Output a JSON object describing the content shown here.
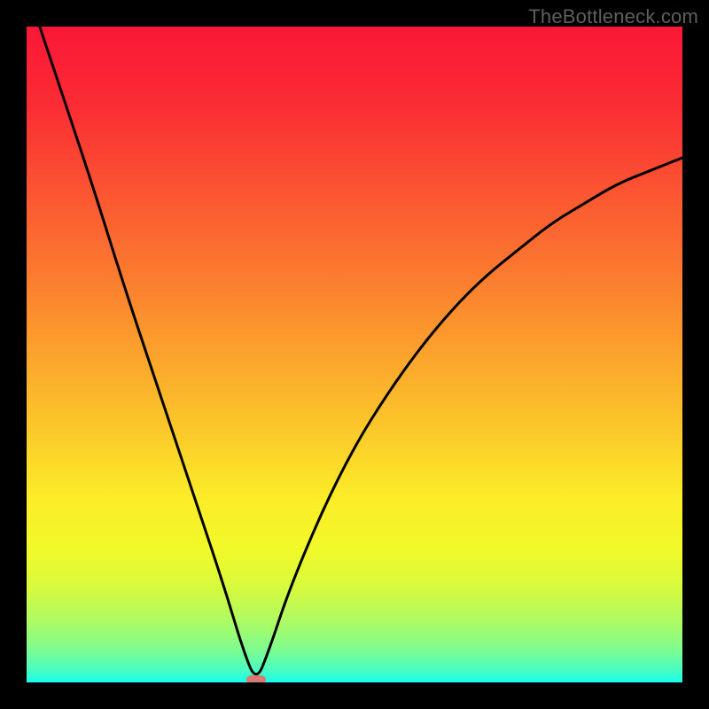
{
  "watermark": "TheBottleneck.com",
  "colors": {
    "bg": "#000000",
    "gradient_stops": [
      {
        "offset": 0.0,
        "color": "#fb1736"
      },
      {
        "offset": 0.12,
        "color": "#fb2c34"
      },
      {
        "offset": 0.25,
        "color": "#fb5431"
      },
      {
        "offset": 0.38,
        "color": "#fb7b2f"
      },
      {
        "offset": 0.5,
        "color": "#fba32c"
      },
      {
        "offset": 0.62,
        "color": "#fbca2a"
      },
      {
        "offset": 0.72,
        "color": "#fbed28"
      },
      {
        "offset": 0.8,
        "color": "#f1f929"
      },
      {
        "offset": 0.86,
        "color": "#d4fa3f"
      },
      {
        "offset": 0.91,
        "color": "#aafb66"
      },
      {
        "offset": 0.95,
        "color": "#7efc8f"
      },
      {
        "offset": 0.98,
        "color": "#4bfdbf"
      },
      {
        "offset": 1.0,
        "color": "#18ffef"
      }
    ],
    "curve": "#000000",
    "marker": "#d97a72",
    "watermark_text": "#5e5e5e"
  },
  "chart_data": {
    "type": "line",
    "title": "",
    "xlabel": "",
    "ylabel": "",
    "xlim": [
      0,
      100
    ],
    "ylim": [
      0,
      100
    ],
    "min_point": {
      "x": 35,
      "y": 0
    },
    "series": [
      {
        "name": "bottleneck_curve",
        "x": [
          2,
          5,
          10,
          15,
          20,
          25,
          30,
          33,
          35,
          37,
          40,
          45,
          50,
          55,
          60,
          65,
          70,
          75,
          80,
          85,
          90,
          95,
          100
        ],
        "y": [
          100,
          91,
          76,
          60,
          45,
          30,
          15,
          5,
          0,
          5,
          14,
          26,
          36,
          44,
          51,
          57,
          62,
          66,
          70,
          73,
          76,
          78,
          80
        ]
      }
    ]
  }
}
